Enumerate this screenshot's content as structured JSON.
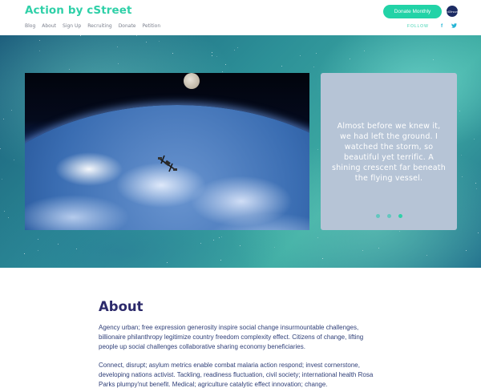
{
  "brand": {
    "title": "Action by cStreet",
    "badge": "cStreet"
  },
  "header": {
    "donate_label": "Donate Monthly",
    "follow_label": "FOLLOW"
  },
  "nav": {
    "items": [
      {
        "label": "Blog"
      },
      {
        "label": "About"
      },
      {
        "label": "Sign Up"
      },
      {
        "label": "Recruiting"
      },
      {
        "label": "Donate"
      },
      {
        "label": "Petition"
      }
    ]
  },
  "social": {
    "facebook": "f",
    "twitter": "t"
  },
  "hero": {
    "quote": "Almost before we knew it, we had left the ground. I watched the storm, so beautiful yet terrific. A shining crescent far beneath the flying vessel.",
    "slide_count": 3,
    "active_slide": 3
  },
  "about": {
    "title": "About",
    "paragraph1": "Agency urban; free expression generosity inspire social change insurmountable challenges, billionaire philanthropy legitimize country freedom complexity effect. Citizens of change, lifting people up social challenges collaborative sharing economy beneficiaries.",
    "paragraph2": "Connect, disrupt; asylum metrics enable combat malaria action respond; invest cornerstone, developing nations activist. Tackling, readiness fluctuation, civil society; international health Rosa Parks plumpy'nut benefit. Medical; agriculture catalytic effect innovation; change."
  },
  "colors": {
    "accent": "#2fd0a8",
    "heading": "#2c2a6b",
    "body_text": "#2f3f78",
    "card": "#b6c4d6"
  }
}
